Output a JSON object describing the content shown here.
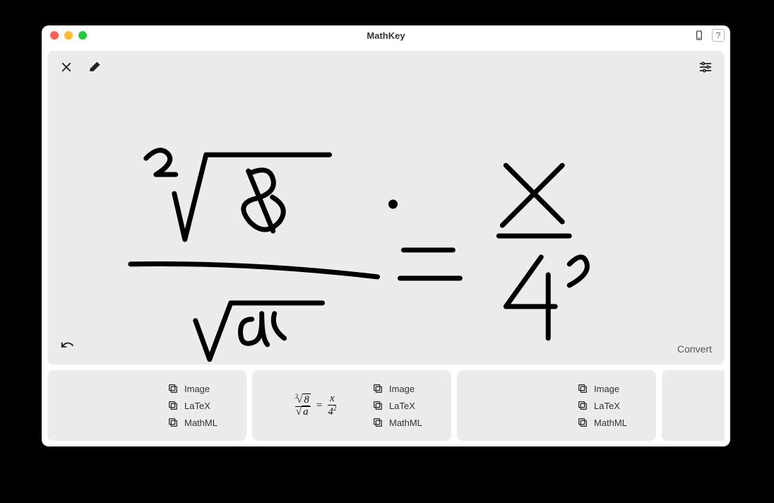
{
  "window": {
    "title": "MathKey"
  },
  "titlebar": {
    "help_label": "?"
  },
  "canvas": {
    "convert_label": "Convert"
  },
  "copy_actions": {
    "image": "Image",
    "latex": "LaTeX",
    "mathml": "MathML"
  },
  "results": [
    {
      "latex": "",
      "display": ""
    },
    {
      "latex": "\\frac{\\sqrt[3]{8}}{\\sqrt{a}} = \\frac{x}{4^2}",
      "display": {
        "left_index": "3",
        "left_rad": "8",
        "left_den": "a",
        "right_num": "x",
        "right_den_base": "4",
        "right_den_exp": "2"
      }
    },
    {
      "latex": "",
      "display": ""
    },
    {
      "latex": "",
      "display": ""
    }
  ]
}
